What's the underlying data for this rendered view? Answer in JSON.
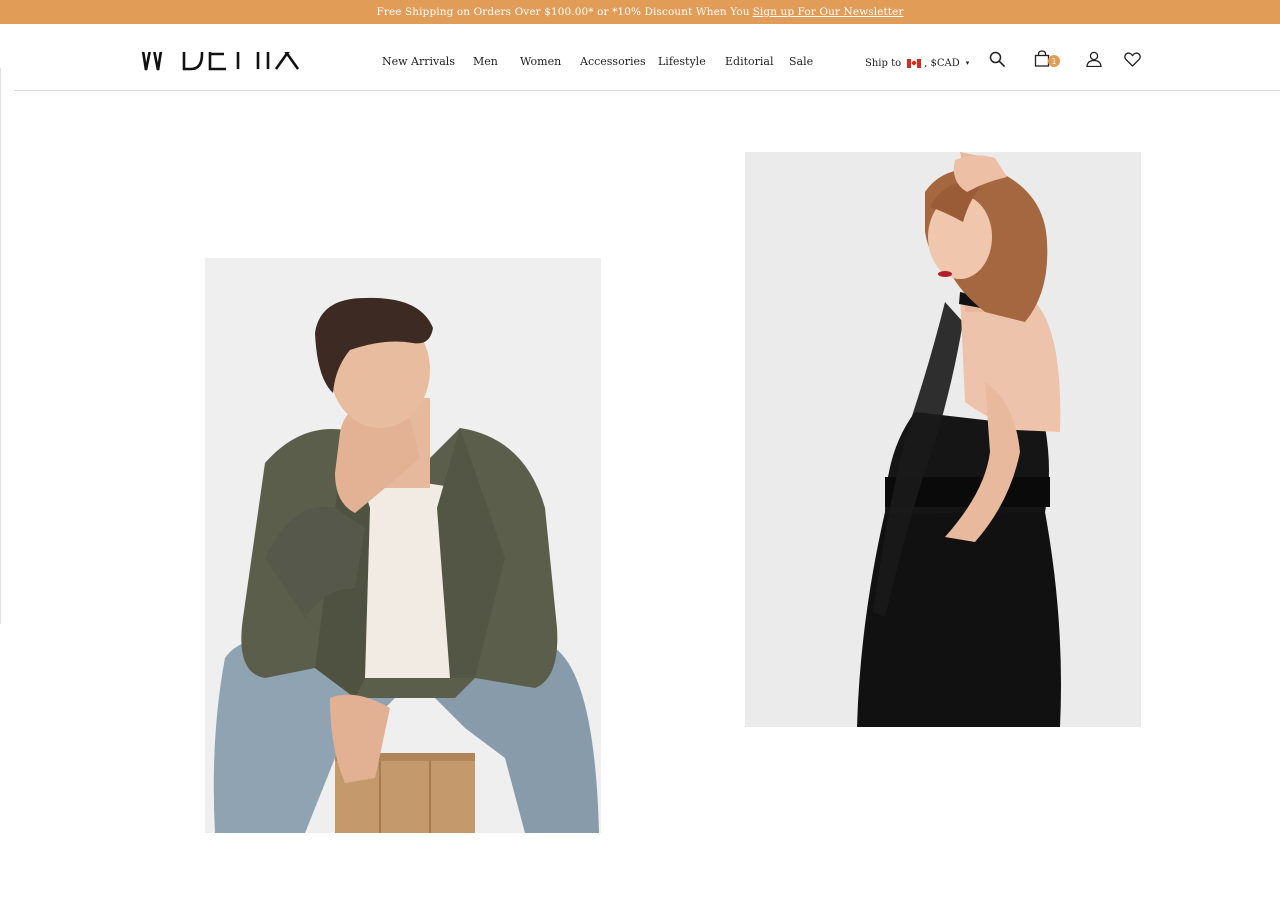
{
  "announcement": {
    "text": "Free Shipping on Orders Over $100.00* or *10% Discount When You",
    "link": "Sign up For Our Newsletter"
  },
  "brand": {
    "logo_name": "brand-logo",
    "accent": "#e19c58"
  },
  "nav": {
    "items": [
      "New Arrivals",
      "Men",
      "Women",
      "Accessories",
      "Lifestyle",
      "Editorial",
      "Sale"
    ]
  },
  "ship": {
    "label": "Ship to",
    "currency": ", $CAD",
    "country": "Canada"
  },
  "header_icons": {
    "search": "search-icon",
    "cart": "cart-icon",
    "cart_count": "1",
    "account": "user-icon",
    "wishlist": "heart-icon"
  },
  "gallery": [
    {
      "subject": "man seated on wooden stool wearing olive jacket and jeans"
    },
    {
      "subject": "woman in black halter dress, hand in hair"
    }
  ]
}
